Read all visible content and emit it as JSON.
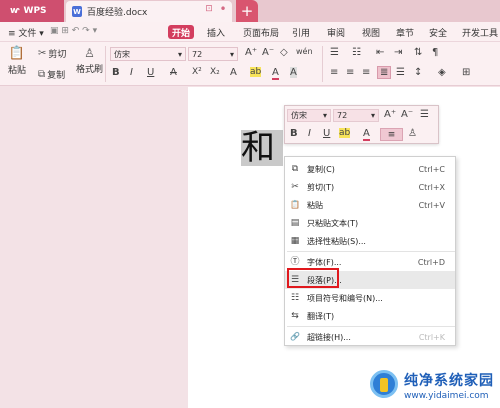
{
  "titlebar": {
    "app_name": "WPS",
    "doc_badge": "W",
    "doc_title": "百度经验.docx",
    "add_tab": "+",
    "restore_glyph": "⊡",
    "dot_glyph": "•"
  },
  "menu": {
    "file": "≡ 文件 ▾",
    "active": "开始",
    "items": [
      "插入",
      "页面布局",
      "引用",
      "审阅",
      "视图",
      "章节",
      "安全",
      "开发工具"
    ]
  },
  "ribbon": {
    "paste": "粘贴",
    "cut": "剪切",
    "copy": "复制",
    "format_painter": "格式刷",
    "font_name": "仿宋",
    "font_size": "72",
    "grow": "A⁺",
    "shrink": "A⁻",
    "clear": "◇",
    "pinyin": "wén",
    "bold": "B",
    "italic": "I",
    "underline": "U",
    "strike": "A",
    "superscript": "X²",
    "subscript": "X₂",
    "text_effect": "A",
    "highlight": "ab",
    "font_color": "A",
    "char_shade": "A",
    "list_bullet": "☰",
    "list_number": "☷",
    "indent_dec": "⇤",
    "indent_inc": "⇥",
    "sort": "⇅",
    "show_marks": "¶",
    "align_left": "≡",
    "align_center": "≡",
    "align_right": "≡",
    "align_justify": "≣",
    "align_dist": "☰",
    "line_spacing": "↕",
    "shading": "◈",
    "border": "⊞"
  },
  "document": {
    "glyph": "和"
  },
  "mini_toolbar": {
    "font_name": "仿宋",
    "font_size": "72",
    "grow": "A⁺",
    "shrink": "A⁻",
    "list": "☰",
    "bold": "B",
    "italic": "I",
    "underline": "U",
    "highlight": "ab",
    "font_color": "A",
    "align": "≡",
    "format_painter": "♙"
  },
  "context_menu": {
    "items": [
      {
        "label": "复制(C)",
        "shortcut": "Ctrl+C",
        "icon": "⧉"
      },
      {
        "label": "剪切(T)",
        "shortcut": "Ctrl+X",
        "icon": "✂"
      },
      {
        "label": "粘贴",
        "shortcut": "Ctrl+V",
        "icon": "📋"
      },
      {
        "label": "只粘贴文本(T)",
        "shortcut": "",
        "icon": "▤"
      },
      {
        "label": "选择性粘贴(S)...",
        "shortcut": "",
        "icon": "▦"
      },
      {
        "label": "字体(F)...",
        "shortcut": "Ctrl+D",
        "icon": "Ⓣ"
      },
      {
        "label": "段落(P)...",
        "shortcut": "",
        "icon": "☰"
      },
      {
        "label": "项目符号和编号(N)...",
        "shortcut": "",
        "icon": "☷"
      },
      {
        "label": "翻译(T)",
        "shortcut": "",
        "icon": "⇆"
      },
      {
        "label": "超链接(H)...",
        "shortcut": "Ctrl+K",
        "icon": "🔗"
      }
    ]
  },
  "watermark": {
    "title": "纯净系统家园",
    "url": "www.yidaimei.com"
  },
  "colors": {
    "accent": "#d33e5f",
    "titlebar_bg": "#e8c8cf",
    "ribbon_bg": "#fbf0f2",
    "highlight_box": "#e0191e"
  }
}
